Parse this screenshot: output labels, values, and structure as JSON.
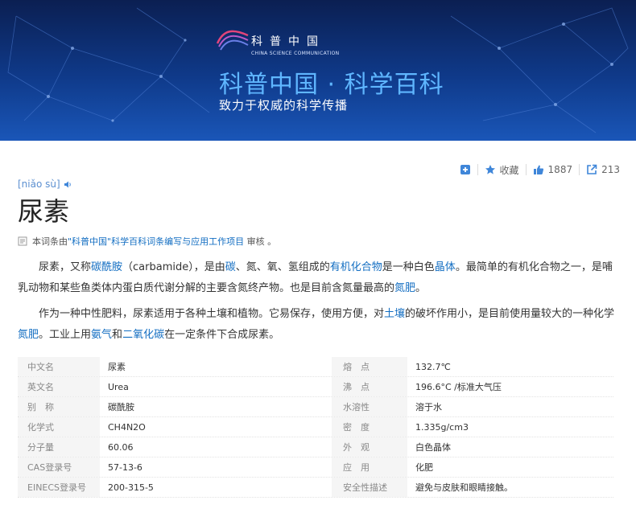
{
  "banner": {
    "logo_cn": "科普中国",
    "logo_en": "CHINA SCIENCE COMMUNICATION",
    "title": "科普中国 · 科学百科",
    "subtitle": "致力于权威的科学传播"
  },
  "toolbar": {
    "collect_label": "收藏",
    "like_count": "1887",
    "share_count": "213"
  },
  "entry": {
    "pinyin": "[niǎo sù]",
    "word": "尿素",
    "review": {
      "prefix": "本词条由",
      "link": "\"科普中国\"科学百科词条编写与应用工作项目",
      "suffix": "审核 。"
    }
  },
  "paragraphs": {
    "p1": [
      {
        "t": "尿素，又称"
      },
      {
        "t": "碳酰胺",
        "link": true
      },
      {
        "t": "（carbamide），是由"
      },
      {
        "t": "碳",
        "link": true
      },
      {
        "t": "、氮、氧、氢组成的"
      },
      {
        "t": "有机化合物",
        "link": true
      },
      {
        "t": "是一种白色"
      },
      {
        "t": "晶体",
        "link": true
      },
      {
        "t": "。最简单的有机化合物之一，是哺乳动物和某些鱼类体内蛋白质代谢分解的主要含氮终产物。也是目前含氮量最高的"
      },
      {
        "t": "氮肥",
        "link": true
      },
      {
        "t": "。"
      }
    ],
    "p2": [
      {
        "t": "作为一种中性肥料，尿素适用于各种土壤和植物。它易保存，使用方便，对"
      },
      {
        "t": "土壤",
        "link": true
      },
      {
        "t": "的破坏作用小，是目前使用量较大的一种化学"
      },
      {
        "t": "氮肥",
        "link": true
      },
      {
        "t": "。工业上用"
      },
      {
        "t": "氨气",
        "link": true
      },
      {
        "t": "和"
      },
      {
        "t": "二氧化碳",
        "link": true
      },
      {
        "t": "在一定条件下合成尿素。"
      }
    ]
  },
  "basic_info": [
    {
      "k1": "中文名",
      "v1": "尿素",
      "k2": "熔　点",
      "v2": "132.7℃"
    },
    {
      "k1": "英文名",
      "v1": "Urea",
      "k2": "沸　点",
      "v2": "196.6°C /标准大气压"
    },
    {
      "k1": "别　称",
      "v1": "碳酰胺",
      "k2": "水溶性",
      "v2": "溶于水"
    },
    {
      "k1": "化学式",
      "v1": " CH4N2O",
      "k2": "密　度",
      "v2": "1.335g/cm3"
    },
    {
      "k1": "分子量",
      "v1": "60.06",
      "k2": "外　观",
      "v2": "白色晶体"
    },
    {
      "k1": "CAS登录号",
      "v1": "57-13-6",
      "k2": "应　用",
      "v2": "化肥"
    },
    {
      "k1": "EINECS登录号",
      "v1": "200-315-5",
      "k2": "安全性描述",
      "v2": "避免与皮肤和眼睛接触。"
    }
  ],
  "colors": {
    "link": "#136ec2",
    "banner_dark": "#0b1f52",
    "banner_light": "#1a56b8",
    "accent": "#5fb6ff",
    "icon_blue": "#3f86d9"
  }
}
